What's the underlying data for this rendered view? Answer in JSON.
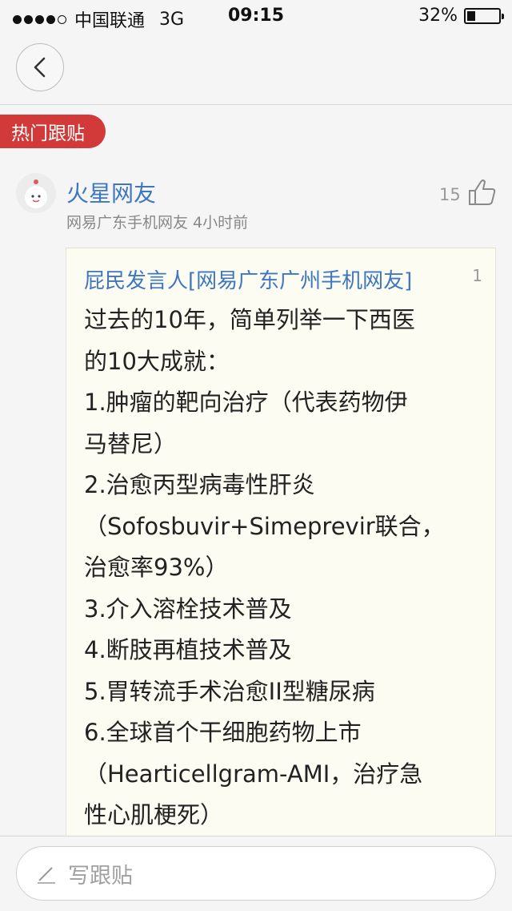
{
  "status_bar": {
    "carrier": "中国联通",
    "network": "3G",
    "time": "09:15",
    "battery": "32%"
  },
  "nav": {
    "back_icon": "chevron-left-icon"
  },
  "section": {
    "hot_label": "热门跟贴"
  },
  "comment": {
    "username": "火星网友",
    "userinfo": "网易广东手机网友 4小时前",
    "likes": "15",
    "quote": {
      "author": "屁民发言人[网易广东广州手机网友]",
      "floor": "1",
      "lines": [
        "过去的10年，简单列举一下西医",
        "的10大成就：",
        "1.肿瘤的靶向治疗（代表药物伊",
        "马替尼）",
        "2.治愈丙型病毒性肝炎",
        "（Sofosbuvir+Simeprevir联合，",
        "治愈率93%）",
        "3.介入溶栓技术普及",
        "4.断肢再植技术普及",
        "5.胃转流手术治愈II型糖尿病",
        "6.全球首个干细胞药物上市",
        "（Hearticellgram-AMI，治疗急",
        "性心肌梗死）"
      ]
    }
  },
  "reply": {
    "placeholder": "写跟贴"
  },
  "colors": {
    "accent_red": "#d23a3a",
    "link_blue": "#3e77c0",
    "quote_bg": "#fcfcf2"
  }
}
